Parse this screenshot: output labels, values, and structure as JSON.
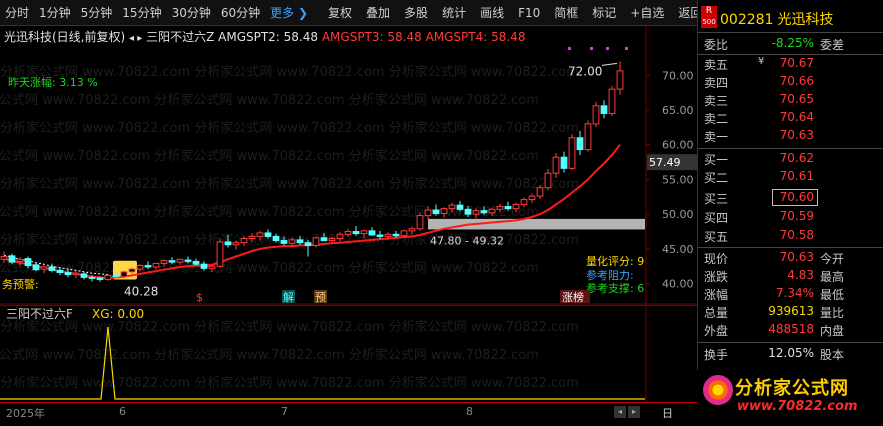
{
  "toolbar": {
    "periods": [
      "分时",
      "1分钟",
      "5分钟",
      "15分钟",
      "30分钟",
      "60分钟"
    ],
    "more": "更多 ❯",
    "actions": [
      "复权",
      "叠加",
      "多股",
      "统计",
      "画线",
      "F10",
      "简框",
      "标记",
      "+自选",
      "返回"
    ]
  },
  "chart": {
    "title": "光迅科技(日线,前复权)",
    "scroll_arrows": "◂ ▸",
    "formula_name": "三阳不过六Z",
    "amg2_label": "AMGSPT2: 58.48",
    "amg3_label": "AMGSPT3: 58.48",
    "amg4_label": "AMGSPT4: 58.48",
    "yesterday_rise": "昨天涨幅: 3.13 %",
    "watermark": "分析家公式网 www.70822.com",
    "high_label": "72.00",
    "low_label": "40.28",
    "range_label": "47.80 - 49.32",
    "current_price_tag": "57.49",
    "quant_score": "量化评分: 9",
    "ref_resist": "参考阻力:",
    "ref_support": "参考支撑: 6",
    "warn_text": "务预警:",
    "tags": [
      "$",
      "解",
      "预",
      "涨榜"
    ],
    "y_ticks": [
      "70.00",
      "65.00",
      "60.00",
      "55.00",
      "50.00",
      "45.00",
      "40.00"
    ]
  },
  "chart_data": {
    "type": "candlestick",
    "title": "光迅科技(日线,前复权)",
    "ylim": [
      37.5,
      74.5
    ],
    "ohlc": [
      [
        43.5,
        44.6,
        43.0,
        43.9
      ],
      [
        44.0,
        44.3,
        42.8,
        43.1
      ],
      [
        43.2,
        43.8,
        42.5,
        43.5
      ],
      [
        43.6,
        43.9,
        42.2,
        42.6
      ],
      [
        42.7,
        43.0,
        41.8,
        42.0
      ],
      [
        42.1,
        42.6,
        41.5,
        42.4
      ],
      [
        42.4,
        42.9,
        41.6,
        41.9
      ],
      [
        41.9,
        42.3,
        41.2,
        41.6
      ],
      [
        41.6,
        42.0,
        40.9,
        41.3
      ],
      [
        41.3,
        41.8,
        40.8,
        41.5
      ],
      [
        41.4,
        41.7,
        40.6,
        40.9
      ],
      [
        40.9,
        41.2,
        40.3,
        40.8
      ],
      [
        40.8,
        41.0,
        40.28,
        40.6
      ],
      [
        40.6,
        41.4,
        40.4,
        41.2
      ],
      [
        41.2,
        41.8,
        40.9,
        41.0
      ],
      [
        41.0,
        41.9,
        40.8,
        41.7
      ],
      [
        41.7,
        42.3,
        41.4,
        42.1
      ],
      [
        42.1,
        42.8,
        41.8,
        42.6
      ],
      [
        42.6,
        43.2,
        42.1,
        42.4
      ],
      [
        42.4,
        43.0,
        42.0,
        42.9
      ],
      [
        42.9,
        43.5,
        42.5,
        43.3
      ],
      [
        43.3,
        43.8,
        42.8,
        43.1
      ],
      [
        43.1,
        43.6,
        42.7,
        43.5
      ],
      [
        43.4,
        43.9,
        42.9,
        43.2
      ],
      [
        43.2,
        43.6,
        42.6,
        42.8
      ],
      [
        42.8,
        43.2,
        41.9,
        42.2
      ],
      [
        42.2,
        42.7,
        41.7,
        42.5
      ],
      [
        42.5,
        46.5,
        42.3,
        46.0
      ],
      [
        46.0,
        47.0,
        45.2,
        45.6
      ],
      [
        45.6,
        46.2,
        44.9,
        45.9
      ],
      [
        45.9,
        46.8,
        45.4,
        46.5
      ],
      [
        46.5,
        47.3,
        46.0,
        46.8
      ],
      [
        46.8,
        47.6,
        46.2,
        47.3
      ],
      [
        47.3,
        47.8,
        46.5,
        46.8
      ],
      [
        46.8,
        47.2,
        45.9,
        46.2
      ],
      [
        46.2,
        46.8,
        45.5,
        45.8
      ],
      [
        45.8,
        46.6,
        45.3,
        46.3
      ],
      [
        46.3,
        46.9,
        45.6,
        45.9
      ],
      [
        45.9,
        46.3,
        43.9,
        45.5
      ],
      [
        45.5,
        46.8,
        45.2,
        46.6
      ],
      [
        46.6,
        47.3,
        46.1,
        46.2
      ],
      [
        46.2,
        46.8,
        45.8,
        46.5
      ],
      [
        46.5,
        47.4,
        46.1,
        47.1
      ],
      [
        47.1,
        47.9,
        46.7,
        47.5
      ],
      [
        47.5,
        48.3,
        46.9,
        47.2
      ],
      [
        47.2,
        47.8,
        46.5,
        47.6
      ],
      [
        47.6,
        48.1,
        46.9,
        47.0
      ],
      [
        47.0,
        47.6,
        46.4,
        46.8
      ],
      [
        46.8,
        47.4,
        46.3,
        47.1
      ],
      [
        47.1,
        47.6,
        46.6,
        46.9
      ],
      [
        46.9,
        47.8,
        46.7,
        47.6
      ],
      [
        47.6,
        48.2,
        47.1,
        47.9
      ],
      [
        47.9,
        50.2,
        47.6,
        49.8
      ],
      [
        49.8,
        51.2,
        49.3,
        50.6
      ],
      [
        50.6,
        51.4,
        49.8,
        50.1
      ],
      [
        50.1,
        51.0,
        49.5,
        50.8
      ],
      [
        50.8,
        51.6,
        50.2,
        51.3
      ],
      [
        51.3,
        51.9,
        50.4,
        50.7
      ],
      [
        50.7,
        51.2,
        49.6,
        50.0
      ],
      [
        50.0,
        50.8,
        49.4,
        50.5
      ],
      [
        50.5,
        51.1,
        49.9,
        50.2
      ],
      [
        50.2,
        50.9,
        49.7,
        50.7
      ],
      [
        50.7,
        51.5,
        50.2,
        51.1
      ],
      [
        51.1,
        51.8,
        50.5,
        50.8
      ],
      [
        50.8,
        51.7,
        50.3,
        51.4
      ],
      [
        51.4,
        52.4,
        51.0,
        52.1
      ],
      [
        52.1,
        53.0,
        51.6,
        52.6
      ],
      [
        52.6,
        54.2,
        52.2,
        53.8
      ],
      [
        53.8,
        56.5,
        53.4,
        55.9
      ],
      [
        55.9,
        58.8,
        55.2,
        58.2
      ],
      [
        58.2,
        59.0,
        56.0,
        56.6
      ],
      [
        56.6,
        61.5,
        56.3,
        61.0
      ],
      [
        61.0,
        62.0,
        58.5,
        59.3
      ],
      [
        59.3,
        63.5,
        59.0,
        63.0
      ],
      [
        63.0,
        66.2,
        62.5,
        65.6
      ],
      [
        65.6,
        66.4,
        63.8,
        64.5
      ],
      [
        64.5,
        68.5,
        64.1,
        68.0
      ],
      [
        68.0,
        72.0,
        67.2,
        70.63
      ]
    ],
    "ma_line": [
      43.6,
      43.3,
      43.0,
      42.8,
      42.5,
      42.3,
      42.0,
      41.8,
      41.6,
      41.4,
      41.2,
      41.0,
      40.9,
      40.8,
      40.9,
      41.0,
      41.2,
      41.4,
      41.6,
      41.8,
      42.0,
      42.2,
      42.4,
      42.5,
      42.6,
      42.6,
      42.7,
      43.1,
      43.5,
      43.9,
      44.3,
      44.7,
      45.0,
      45.2,
      45.3,
      45.4,
      45.4,
      45.5,
      45.5,
      45.6,
      45.7,
      45.8,
      45.9,
      46.0,
      46.1,
      46.2,
      46.3,
      46.4,
      46.5,
      46.6,
      46.7,
      46.8,
      47.0,
      47.3,
      47.6,
      47.9,
      48.1,
      48.3,
      48.5,
      48.6,
      48.7,
      48.8,
      48.9,
      49.0,
      49.1,
      49.3,
      49.6,
      50.0,
      50.6,
      51.4,
      52.2,
      53.1,
      54.0,
      55.0,
      56.2,
      57.3,
      58.5,
      60.0
    ],
    "support_band": [
      47.8,
      49.32
    ],
    "indicator": {
      "name": "三阳不过六F",
      "label": "XG: 0.00",
      "spike_index": 13
    }
  },
  "indicator": {
    "title": "三阳不过六F",
    "xg": "XG: 0.00"
  },
  "time_axis": {
    "labels": [
      "2025年",
      "6",
      "7",
      "8"
    ],
    "scroll_left": "◂",
    "scroll_right": "▸",
    "day_btn": "日"
  },
  "panel": {
    "badge_top": "R",
    "badge_bottom": "500",
    "code": "002281",
    "name": "光迅科技",
    "weibi": {
      "label": "委比",
      "value": "-8.25%",
      "tail": "委差"
    },
    "asks": [
      {
        "label": "卖五",
        "mark": "¥",
        "price": "70.67"
      },
      {
        "label": "卖四",
        "price": "70.66"
      },
      {
        "label": "卖三",
        "price": "70.65"
      },
      {
        "label": "卖二",
        "price": "70.64"
      },
      {
        "label": "卖一",
        "price": "70.63"
      }
    ],
    "bids": [
      {
        "label": "买一",
        "price": "70.62"
      },
      {
        "label": "买二",
        "price": "70.61"
      },
      {
        "label": "买三",
        "price": "70.60"
      },
      {
        "label": "买四",
        "price": "70.59"
      },
      {
        "label": "买五",
        "price": "70.58"
      }
    ],
    "stats": [
      {
        "label": "现价",
        "value": "70.63",
        "tail": "今开",
        "color": "red"
      },
      {
        "label": "涨跌",
        "value": "4.83",
        "tail": "最高",
        "color": "red"
      },
      {
        "label": "涨幅",
        "value": "7.34%",
        "tail": "最低",
        "color": "red"
      },
      {
        "label": "总量",
        "value": "939613",
        "tail": "量比",
        "color": "yellow"
      },
      {
        "label": "外盘",
        "value": "488518",
        "tail": "内盘",
        "color": "red"
      }
    ],
    "turnover": {
      "label": "换手",
      "value": "12.05%",
      "tail": "股本"
    }
  },
  "brand": {
    "title": "分析家公式网",
    "url": "www.70822.com"
  },
  "colors": {
    "up": "#ff3b3b",
    "down": "#54ffff",
    "ma": "#ff1a1a",
    "band": "#b4b4b4",
    "accent": "#ffd700"
  }
}
